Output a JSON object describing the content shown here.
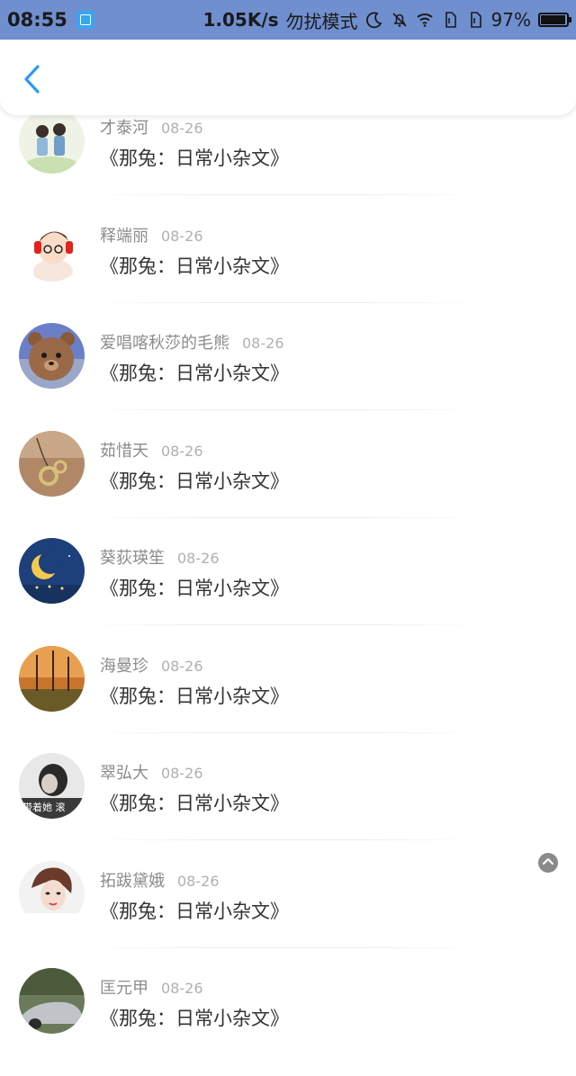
{
  "status_bar": {
    "time": "08:55",
    "speed": "1.05K/s",
    "mode": "勿扰模式",
    "battery": "97%",
    "battery_level": 0.97
  },
  "nav": {
    "back_icon": "chevron-left-icon",
    "accent": "#2b9af3"
  },
  "items": [
    {
      "name": "才泰河",
      "date": "08-26",
      "title": "《那兔：日常小杂文》"
    },
    {
      "name": "释端丽",
      "date": "08-26",
      "title": "《那兔：日常小杂文》"
    },
    {
      "name": "爱唱喀秋莎的毛熊",
      "date": "08-26",
      "title": "《那兔：日常小杂文》"
    },
    {
      "name": "茹惜天",
      "date": "08-26",
      "title": "《那兔：日常小杂文》"
    },
    {
      "name": "葵荻瑛笙",
      "date": "08-26",
      "title": "《那兔：日常小杂文》"
    },
    {
      "name": "海曼珍",
      "date": "08-26",
      "title": "《那兔：日常小杂文》"
    },
    {
      "name": "翠弘大",
      "date": "08-26",
      "title": "《那兔：日常小杂文》"
    },
    {
      "name": "拓跋黛娥",
      "date": "08-26",
      "title": "《那兔：日常小杂文》"
    },
    {
      "name": "匡元甲",
      "date": "08-26",
      "title": "《那兔：日常小杂文》"
    }
  ],
  "avatar_watermark": "带着她 滚"
}
